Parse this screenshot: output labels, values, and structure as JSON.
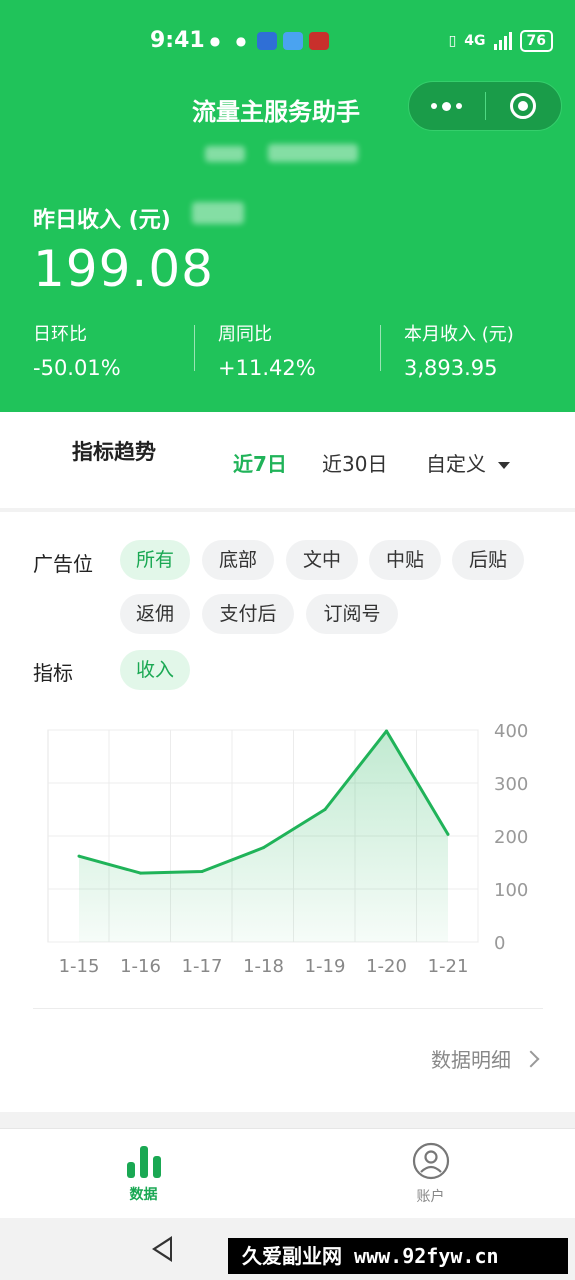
{
  "status_bar": {
    "time": "9:41",
    "network": "4G",
    "battery": "76"
  },
  "app": {
    "title": "流量主服务助手"
  },
  "income": {
    "label": "昨日收入 (元)",
    "value": "199.08",
    "stats": [
      {
        "label": "日环比",
        "value": "-50.01%"
      },
      {
        "label": "周同比",
        "value": "+11.42%"
      },
      {
        "label": "本月收入 (元)",
        "value": "3,893.95"
      }
    ]
  },
  "trend": {
    "title": "指标趋势",
    "ranges": [
      {
        "label": "近7日",
        "active": true
      },
      {
        "label": "近30日",
        "active": false
      },
      {
        "label": "自定义",
        "active": false
      }
    ]
  },
  "filters": {
    "ad_label": "广告位",
    "ad_chips": [
      "所有",
      "底部",
      "文中",
      "中贴",
      "后贴",
      "返佣",
      "支付后",
      "订阅号"
    ],
    "ad_active": "所有",
    "metric_label": "指标",
    "metric_chip": "收入"
  },
  "chart_data": {
    "type": "area",
    "categories": [
      "1-15",
      "1-16",
      "1-17",
      "1-18",
      "1-19",
      "1-20",
      "1-21"
    ],
    "values": [
      162,
      130,
      133,
      178,
      250,
      398,
      203
    ],
    "ylim": [
      0,
      400
    ],
    "yticks": [
      0,
      100,
      200,
      300,
      400
    ],
    "grid": true,
    "y_axis_side": "right",
    "color": "#20b359"
  },
  "detail": {
    "label": "数据明细"
  },
  "tabbar": {
    "tabs": [
      {
        "label": "数据",
        "icon": "bar-chart-icon",
        "active": true
      },
      {
        "label": "账户",
        "icon": "user-icon",
        "active": false
      }
    ]
  },
  "watermark_banner": "久爱副业网 www.92fyw.cn",
  "colors": {
    "brand": "#20c35a",
    "accent": "#20b359"
  }
}
